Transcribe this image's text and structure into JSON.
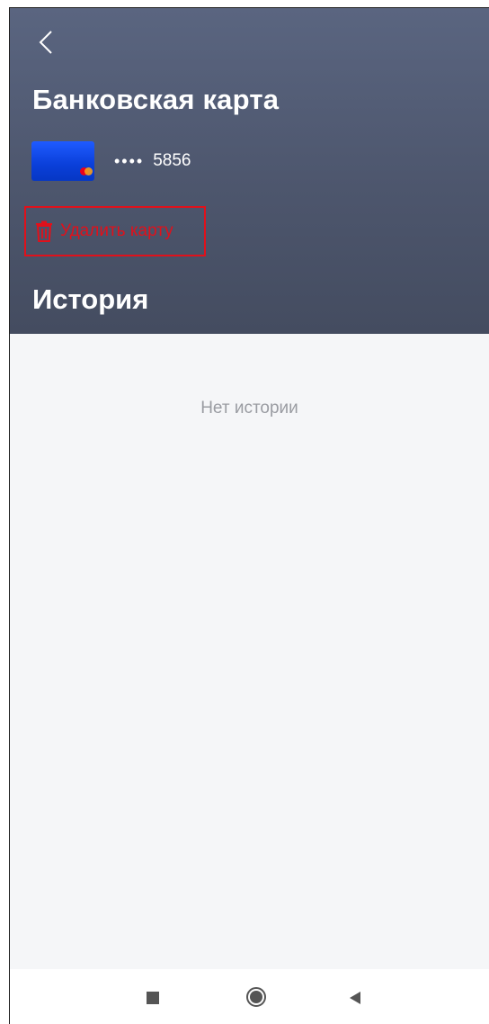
{
  "header": {
    "back_icon": "chevron-left-icon",
    "title": "Банковская карта"
  },
  "card": {
    "masked_dots": "••••",
    "last4": "5856",
    "brand_icon": "mastercard-icon",
    "card_color": "#1149e8"
  },
  "actions": {
    "delete_label": "Удалить карту",
    "delete_icon": "trash-icon",
    "delete_color": "#e0111b"
  },
  "history": {
    "title": "История",
    "empty_text": "Нет истории"
  },
  "navbar": {
    "recents_icon": "square-icon",
    "home_icon": "circle-icon",
    "back_icon": "triangle-back-icon"
  }
}
